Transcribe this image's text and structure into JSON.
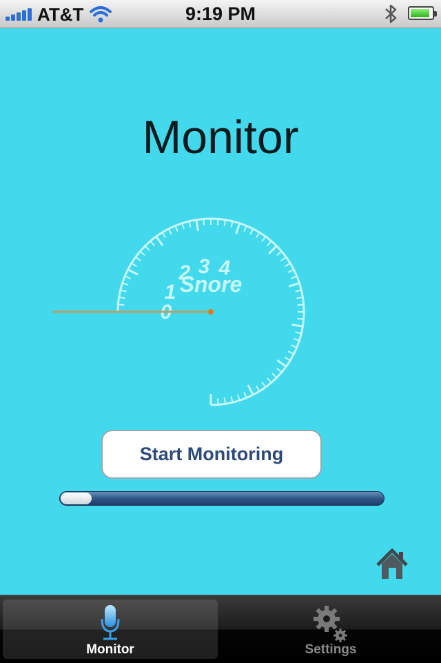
{
  "status_bar": {
    "carrier": "AT&T",
    "time": "9:19 PM",
    "signal_bars": 5,
    "battery_level": 0.9
  },
  "page": {
    "title": "Monitor"
  },
  "gauge": {
    "label": "Snore",
    "scale_labels": [
      "0",
      "1",
      "2",
      "3",
      "4"
    ],
    "needle_value": 0,
    "needle_color": "#e07a1a",
    "dial_color": "#c8f6f7"
  },
  "actions": {
    "start_label": "Start Monitoring"
  },
  "progress": {
    "level": 0.1
  },
  "tabbar": {
    "tabs": [
      {
        "label": "Monitor",
        "icon": "microphone-icon",
        "selected": true
      },
      {
        "label": "Settings",
        "icon": "gears-icon",
        "selected": false
      }
    ]
  },
  "colors": {
    "background": "#42d9ec",
    "button_text": "#2d4a78",
    "progress_track": "#2f5687"
  }
}
